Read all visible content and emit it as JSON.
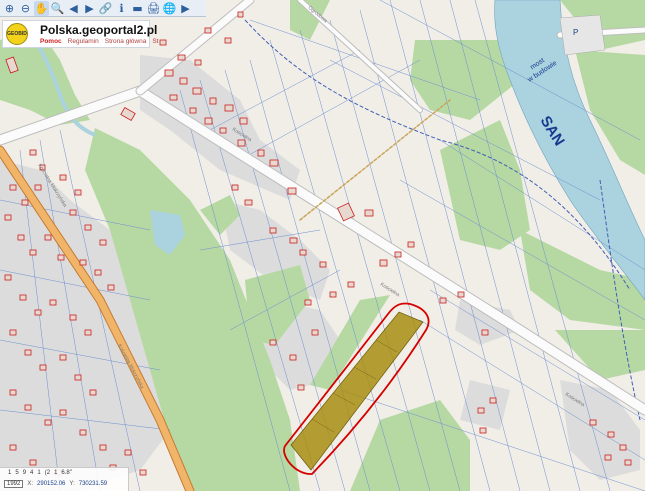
{
  "toolbar": {
    "tools": [
      {
        "name": "zoom-in-icon",
        "glyph": "⊕"
      },
      {
        "name": "zoom-out-icon",
        "glyph": "⊖"
      },
      {
        "name": "pan-hand-icon",
        "glyph": "✋",
        "active": true
      },
      {
        "name": "magnifier-icon",
        "glyph": "🔍"
      },
      {
        "name": "previous-view-icon",
        "glyph": "◀"
      },
      {
        "name": "next-view-icon",
        "glyph": "▶"
      },
      {
        "name": "link-icon",
        "glyph": "🔗"
      },
      {
        "name": "info-icon",
        "glyph": "ℹ"
      },
      {
        "name": "measure-icon",
        "glyph": "▬"
      },
      {
        "name": "print-icon",
        "glyph": "🖨"
      },
      {
        "name": "globe-icon",
        "glyph": "🌐"
      },
      {
        "name": "video-icon",
        "glyph": "▶"
      }
    ]
  },
  "brand": {
    "logo_text": "GEOBID",
    "title": "Polska.geoportal2.pl",
    "links": [
      "Pomoc",
      "Regulamin",
      "Strona główna",
      "St"
    ]
  },
  "map_labels": {
    "river": "SAN",
    "bridge_line1": "most",
    "bridge_line2": "w budowie",
    "parking": "P",
    "street_main": "Kościelna",
    "street_main_2": "Kościelna",
    "street_main_3": "Kościelna",
    "street_left": "Kościelna Mokrzyńska",
    "street_left_2": "Kościelna Mokrzyńska",
    "street_top": "Ogrodowa"
  },
  "status": {
    "scale_buttons": [
      "1",
      "5",
      "9",
      "4",
      "1",
      "(2",
      "1",
      "6.8\""
    ],
    "scale": "1992",
    "x_label": "X:",
    "x_value": "290152.06",
    "y_label": "Y:",
    "y_value": "730231.59"
  },
  "colors": {
    "background": "#f1eee7",
    "forest": "#b6d9a3",
    "river": "#aad3df",
    "road": "#f7f7f7",
    "main_road": "#f1b56a",
    "building_outline": "#c81e1e",
    "parcel_line": "#6d8fd0",
    "highlight_fill": "#a88d12",
    "highlight_outline": "#d50000"
  }
}
